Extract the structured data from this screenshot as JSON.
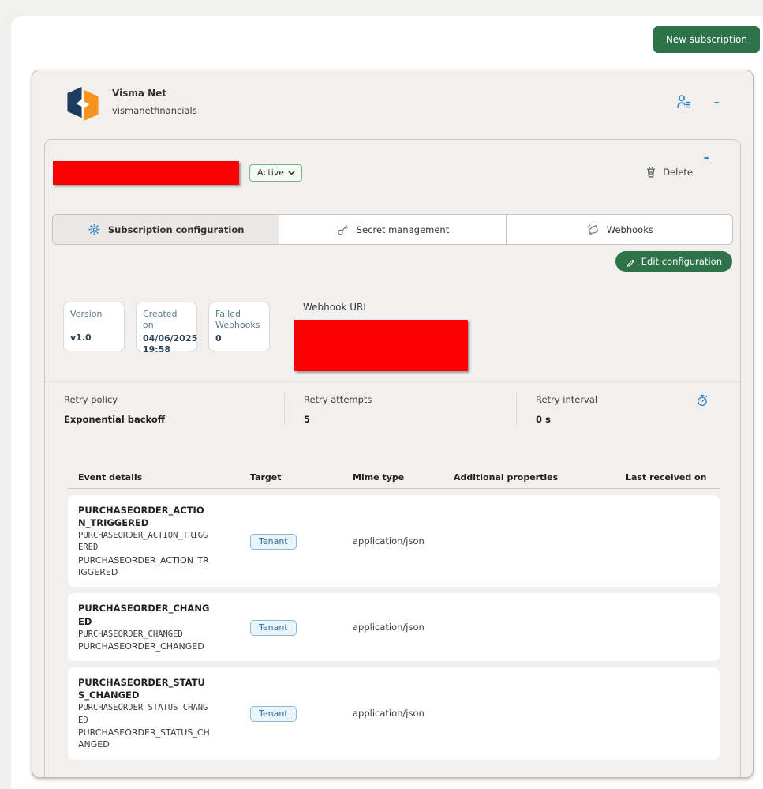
{
  "page": {
    "new_subscription_label": "New subscription"
  },
  "app": {
    "name": "Visma Net",
    "id": "vismanetfinancials",
    "icons": [
      "visma-logo",
      "user-list-icon",
      "collapse-minus-icon"
    ]
  },
  "subscription": {
    "status": "Active",
    "delete_label": "Delete",
    "tabs": [
      {
        "label": "Subscription configuration",
        "icon": "gear-icon",
        "active": true
      },
      {
        "label": "Secret management",
        "icon": "key-icon",
        "active": false
      },
      {
        "label": "Webhooks",
        "icon": "megaphone-icon",
        "active": false
      }
    ],
    "edit_label": "Edit configuration",
    "cards": [
      {
        "label": "Version",
        "value": "v1.0"
      },
      {
        "label": "Created on",
        "value": "04/06/2025 19:58"
      },
      {
        "label": "Failed Webhooks",
        "value": "0"
      }
    ],
    "webhook_uri_label": "Webhook URI",
    "retry_policy": {
      "label": "Retry policy",
      "value": "Exponential backoff"
    },
    "retry_attempts": {
      "label": "Retry attempts",
      "value": "5"
    },
    "retry_interval": {
      "label": "Retry interval",
      "value": "0 s",
      "icon": "stopwatch-icon"
    }
  },
  "events_table": {
    "columns": [
      "Event details",
      "Target",
      "Mime type",
      "Additional properties",
      "Last received on"
    ],
    "rows": [
      {
        "name": "PURCHASEORDER_ACTION_TRIGGERED",
        "code": "PURCHASEORDER_ACTION_TRIGGERED",
        "description": "PURCHASEORDER_ACTION_TRIGGERED",
        "target": "Tenant",
        "mime_type": "application/json",
        "additional_properties": "",
        "last_received_on": ""
      },
      {
        "name": "PURCHASEORDER_CHANGED",
        "code": "PURCHASEORDER_CHANGED",
        "description": "PURCHASEORDER_CHANGED",
        "target": "Tenant",
        "mime_type": "application/json",
        "additional_properties": "",
        "last_received_on": ""
      },
      {
        "name": "PURCHASEORDER_STATUS_CHANGED",
        "code": "PURCHASEORDER_STATUS_CHANGED",
        "description": "PURCHASEORDER_STATUS_CHANGED",
        "target": "Tenant",
        "mime_type": "application/json",
        "additional_properties": "",
        "last_received_on": ""
      }
    ]
  },
  "colors": {
    "accent_green": "#2d7249",
    "accent_blue": "#2e81c4",
    "redaction_red": "#fb0000",
    "logo_navy": "#1c3b5d",
    "logo_orange": "#f7941e"
  }
}
